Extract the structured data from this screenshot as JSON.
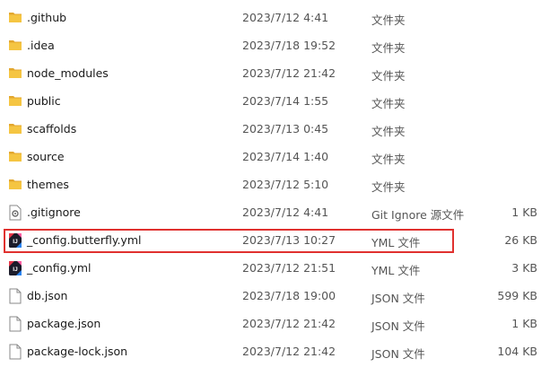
{
  "colors": {
    "folder": "#f5c542",
    "folder_dark": "#e3a72f",
    "highlight_border": "#e0312f",
    "secondary_text": "#555555"
  },
  "rows": [
    {
      "name": ".github",
      "date": "2023/7/12 4:41",
      "type": "文件夹",
      "size": "",
      "icon": "folder-icon"
    },
    {
      "name": ".idea",
      "date": "2023/7/18 19:52",
      "type": "文件夹",
      "size": "",
      "icon": "folder-icon"
    },
    {
      "name": "node_modules",
      "date": "2023/7/12 21:42",
      "type": "文件夹",
      "size": "",
      "icon": "folder-icon"
    },
    {
      "name": "public",
      "date": "2023/7/14 1:55",
      "type": "文件夹",
      "size": "",
      "icon": "folder-icon"
    },
    {
      "name": "scaffolds",
      "date": "2023/7/13 0:45",
      "type": "文件夹",
      "size": "",
      "icon": "folder-icon"
    },
    {
      "name": "source",
      "date": "2023/7/14 1:40",
      "type": "文件夹",
      "size": "",
      "icon": "folder-icon"
    },
    {
      "name": "themes",
      "date": "2023/7/12 5:10",
      "type": "文件夹",
      "size": "",
      "icon": "folder-icon"
    },
    {
      "name": ".gitignore",
      "date": "2023/7/12 4:41",
      "type": "Git Ignore 源文件",
      "size": "1 KB",
      "icon": "gitignore-file-icon"
    },
    {
      "name": "_config.butterfly.yml",
      "date": "2023/7/13 10:27",
      "type": "YML 文件",
      "size": "26 KB",
      "icon": "yml-file-icon"
    },
    {
      "name": "_config.yml",
      "date": "2023/7/12 21:51",
      "type": "YML 文件",
      "size": "3 KB",
      "icon": "yml-file-icon"
    },
    {
      "name": "db.json",
      "date": "2023/7/18 19:00",
      "type": "JSON 文件",
      "size": "599 KB",
      "icon": "document-icon"
    },
    {
      "name": "package.json",
      "date": "2023/7/12 21:42",
      "type": "JSON 文件",
      "size": "1 KB",
      "icon": "document-icon"
    },
    {
      "name": "package-lock.json",
      "date": "2023/7/12 21:42",
      "type": "JSON 文件",
      "size": "104 KB",
      "icon": "document-icon"
    }
  ]
}
